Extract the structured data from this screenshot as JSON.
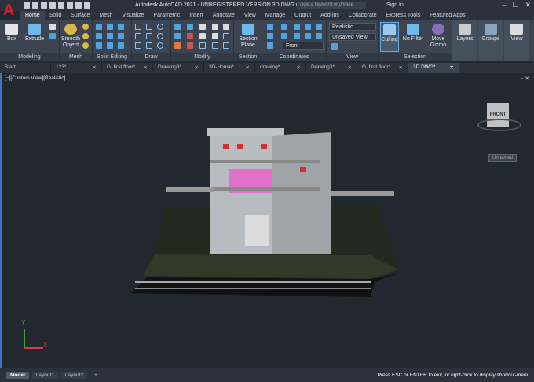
{
  "app": {
    "logo": "A",
    "title": "Autodesk AutoCAD 2021 - UNREGISTERED VERSION   3D DWG.dwg",
    "search_placeholder": "Type a keyword or phrase",
    "sign_in": "Sign In"
  },
  "menu_tabs": [
    "Home",
    "Solid",
    "Surface",
    "Mesh",
    "Visualize",
    "Parametric",
    "Insert",
    "Annotate",
    "View",
    "Manage",
    "Output",
    "Add-ins",
    "Collaborate",
    "Express Tools",
    "Featured Apps"
  ],
  "ribbon": {
    "box": "Box",
    "extrude": "Extrude",
    "smooth_object": "Smooth Object",
    "section_plane": "Section Plane",
    "visual_style": "Realistic",
    "named_view": "Unsaved View",
    "ucs_view": "Front",
    "culling": "Culling",
    "no_filter": "No Filter",
    "move_gizmo": "Move Gizmo",
    "layers": "Layers",
    "groups": "Groups",
    "view": "View",
    "panels": [
      "Modeling",
      "Mesh",
      "Solid Editing",
      "Draw",
      "Modify",
      "Section",
      "Coordinates",
      "View",
      "Selection"
    ]
  },
  "file_tabs": [
    {
      "label": "Start"
    },
    {
      "label": "123*"
    },
    {
      "label": "G, first floor*"
    },
    {
      "label": "Drawing3*"
    },
    {
      "label": "3D-House*"
    },
    {
      "label": "drawing*"
    },
    {
      "label": "Drawing3*"
    },
    {
      "label": "G, first floor*"
    },
    {
      "label": "3D DWG*"
    }
  ],
  "viewport": {
    "label": "[−][Custom View][Realistic]",
    "viewcube_face": "FRONT",
    "ucs_name": "Unnamed",
    "axis_x": "X",
    "axis_y": "Y"
  },
  "layout_tabs": [
    "Model",
    "Layout1",
    "Layout2",
    "+"
  ],
  "status": "Press ESC or ENTER to exit, or right-click to display shortcut-menu."
}
